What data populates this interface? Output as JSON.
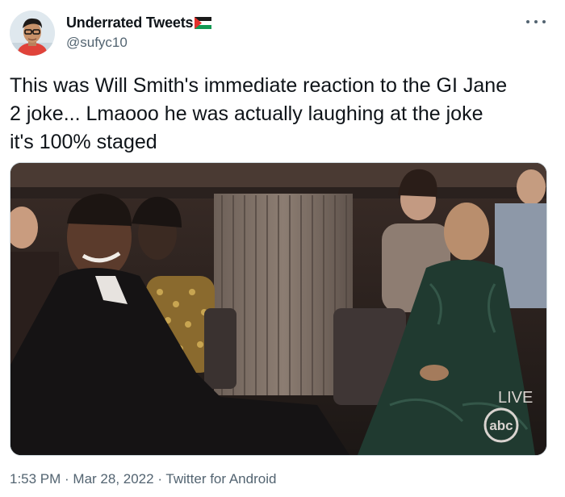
{
  "tweet": {
    "display_name": "Underrated Tweets",
    "handle": "@sufyc10",
    "text": "This was Will Smith's immediate reaction to the GI Jane\n2 joke... Lmaooo he was actually laughing at the joke\nit's 100% staged",
    "time": "1:53 PM",
    "date": "Mar 28, 2022",
    "source": "Twitter for Android",
    "separator": " · "
  },
  "media": {
    "live_label": "LIVE",
    "network_logo": "abc"
  },
  "icons": {
    "more": "more-horizontal-icon",
    "flag": "palestine-flag-icon",
    "avatar": "profile-avatar"
  }
}
